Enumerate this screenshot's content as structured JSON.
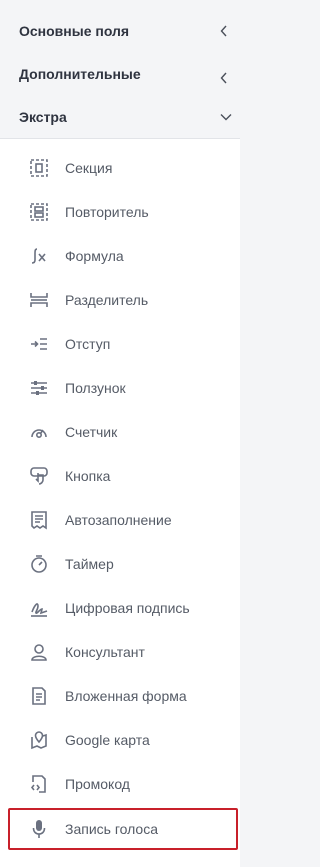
{
  "sections": [
    {
      "title": "Основные поля",
      "state": "collapsed"
    },
    {
      "title": "Дополнительные",
      "state": "collapsed"
    },
    {
      "title": "Экстра",
      "state": "expanded"
    }
  ],
  "items": [
    {
      "label": "Секция",
      "icon": "section-icon"
    },
    {
      "label": "Повторитель",
      "icon": "repeater-icon"
    },
    {
      "label": "Формула",
      "icon": "formula-icon"
    },
    {
      "label": "Разделитель",
      "icon": "separator-icon"
    },
    {
      "label": "Отступ",
      "icon": "indent-icon"
    },
    {
      "label": "Ползунок",
      "icon": "slider-icon"
    },
    {
      "label": "Счетчик",
      "icon": "counter-icon"
    },
    {
      "label": "Кнопка",
      "icon": "button-pointer-icon"
    },
    {
      "label": "Автозаполнение",
      "icon": "autofill-icon"
    },
    {
      "label": "Таймер",
      "icon": "timer-icon"
    },
    {
      "label": "Цифровая подпись",
      "icon": "signature-icon"
    },
    {
      "label": "Консультант",
      "icon": "user-icon"
    },
    {
      "label": "Вложенная форма",
      "icon": "nested-form-icon"
    },
    {
      "label": "Google карта",
      "icon": "map-icon"
    },
    {
      "label": "Промокод",
      "icon": "promocode-icon"
    },
    {
      "label": "Запись голоса",
      "icon": "microphone-icon",
      "selected": true
    }
  ],
  "colors": {
    "panel_bg": "#f4f5f7",
    "list_bg": "#ffffff",
    "icon": "#6b7180",
    "selected_border": "#c8202a"
  }
}
